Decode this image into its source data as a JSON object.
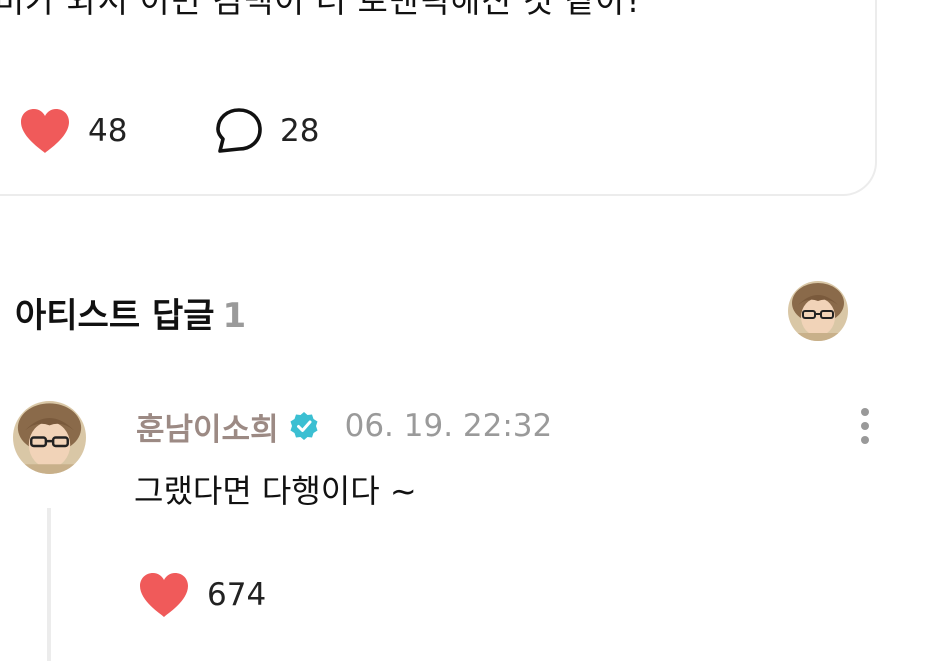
{
  "post": {
    "text": "비가 와서 이번 컴백이 더 로맨틱해진 것 같아!",
    "like_count": "48",
    "comment_count": "28"
  },
  "artist_replies": {
    "title": "아티스트 답글",
    "count": "1"
  },
  "reply": {
    "author": "훈남이소희",
    "timestamp": "06. 19. 22:32",
    "text": "그랬다면 다행이다 ~",
    "like_count": "674"
  },
  "icons": {
    "like": "heart-icon",
    "comment": "speech-bubble-icon",
    "verified": "verified-badge-icon",
    "more": "more-vertical-icon"
  },
  "colors": {
    "heart": "#f05a5a",
    "verified": "#3bbfd2",
    "author": "#9c8a84",
    "muted": "#9a9a9a"
  }
}
